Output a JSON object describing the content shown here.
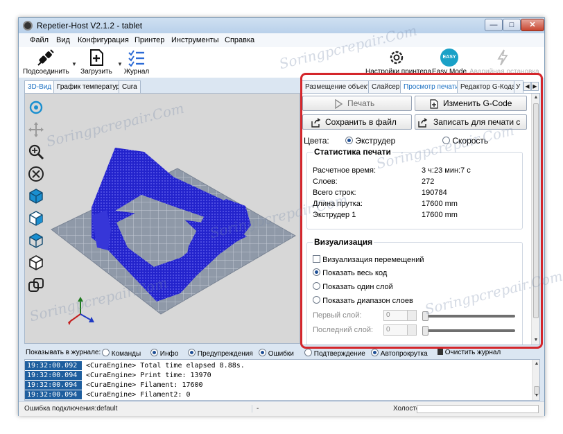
{
  "window": {
    "title": "Repetier-Host V2.1.2 - tablet",
    "min_label": "—",
    "max_label": "□",
    "close_label": "✕"
  },
  "menu": [
    "Файл",
    "Вид",
    "Конфигурация",
    "Принтер",
    "Инструменты",
    "Справка"
  ],
  "toolbar": {
    "connect": "Подсоединить",
    "load": "Загрузить",
    "log": "Журнал",
    "printer_settings": "Настройки принтера",
    "easy_mode": "Easy Mode",
    "easy_badge": "EASY",
    "emergency": "Аварийная остановка"
  },
  "left_tabs": [
    "3D-Вид",
    "График температур",
    "Cura"
  ],
  "right_tabs": [
    "Размещение объекта",
    "Слайсер",
    "Просмотр печати",
    "Редактор G-Кода",
    "У"
  ],
  "actions": {
    "print": "Печать",
    "edit_gcode": "Изменить G-Code",
    "save_file": "Сохранить в файл",
    "save_sd": "Записать для печати с"
  },
  "colors": {
    "label": "Цвета:",
    "extruder": "Экструдер",
    "speed": "Скорость"
  },
  "stats": {
    "title": "Статистика печати",
    "rows": [
      {
        "label": "Расчетное время:",
        "value": "3 ч:23 мин:7 с"
      },
      {
        "label": "Слоев:",
        "value": "272"
      },
      {
        "label": "Всего строк:",
        "value": "190784"
      },
      {
        "label": "Длина прутка:",
        "value": "17600 mm"
      },
      {
        "label": "Экструдер 1",
        "value": "17600 mm"
      }
    ]
  },
  "visual": {
    "title": "Визуализация",
    "show_moves": "Визуализация перемещений",
    "show_all": "Показать весь код",
    "show_one": "Показать один слой",
    "show_range": "Показать диапазон слоев",
    "first_layer": "Первый слой:",
    "last_layer": "Последний слой:",
    "first_value": "0",
    "last_value": "0"
  },
  "logbar": {
    "label": "Показывать в журнале:",
    "commands": "Команды",
    "info": "Инфо",
    "warnings": "Предупреждения",
    "errors": "Ошибки",
    "ack": "Подтверждение",
    "autoscroll": "Автопрокрутка",
    "clear": "Очистить журнал"
  },
  "log": [
    {
      "time": "19:32:00.092",
      "msg": "<CuraEngine> Total time elapsed  8.88s."
    },
    {
      "time": "19:32:00.094",
      "msg": "<CuraEngine> Print time: 13970"
    },
    {
      "time": "19:32:00.094",
      "msg": "<CuraEngine> Filament: 17600"
    },
    {
      "time": "19:32:00.094",
      "msg": "<CuraEngine> Filament2: 0"
    }
  ],
  "status": {
    "connection": "Ошибка подключения:default",
    "middle": "-",
    "idle": "Холостой ход"
  },
  "watermark": "Soringpcrepair.Com",
  "accent": {
    "highlight": "#d4262b",
    "model": "#2323cc",
    "active_tab": "#1a6fc2"
  }
}
